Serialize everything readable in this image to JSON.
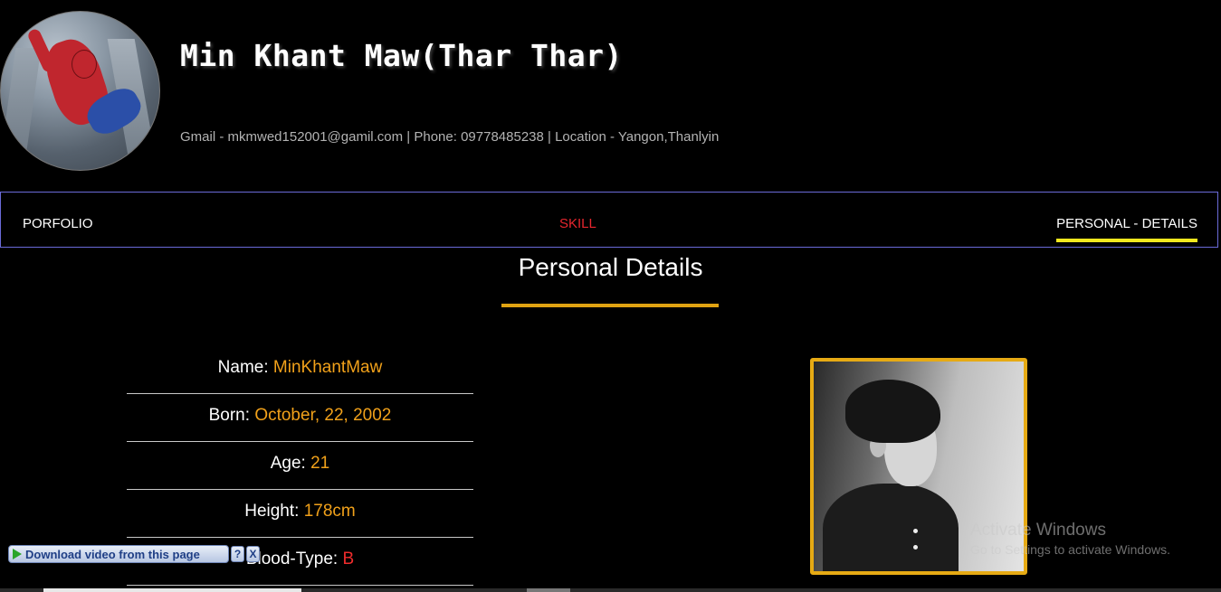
{
  "header": {
    "name": "Min Khant Maw(Thar Thar)",
    "contact": "Gmail - mkmwed152001@gamil.com | Phone: 09778485238 | Location - Yangon,Thanlyin"
  },
  "nav": {
    "items": [
      {
        "label": "PORFOLIO"
      },
      {
        "label": "SKILL"
      },
      {
        "label": "PERSONAL - DETAILS"
      }
    ],
    "active": "PERSONAL - DETAILS"
  },
  "section": {
    "title": "Personal Details"
  },
  "details": [
    {
      "label": "Name:",
      "value": "MinKhantMaw"
    },
    {
      "label": "Born:",
      "value": "October, 22, 2002"
    },
    {
      "label": "Age:",
      "value": "21"
    },
    {
      "label": "Height:",
      "value": "178cm"
    },
    {
      "label": "Blood-Type:",
      "value": "B"
    }
  ],
  "windows_watermark": {
    "line1": "Activate Windows",
    "line2": "Go to Settings to activate Windows."
  },
  "download_bar": {
    "label": "Download video from this page",
    "help": "?",
    "close": "X"
  },
  "colors": {
    "accent_gold": "#e6aa14",
    "value_orange": "#f1a11a",
    "skill_red": "#e8262e",
    "active_underline": "#f2e81e",
    "nav_border": "#6a6ad8"
  }
}
